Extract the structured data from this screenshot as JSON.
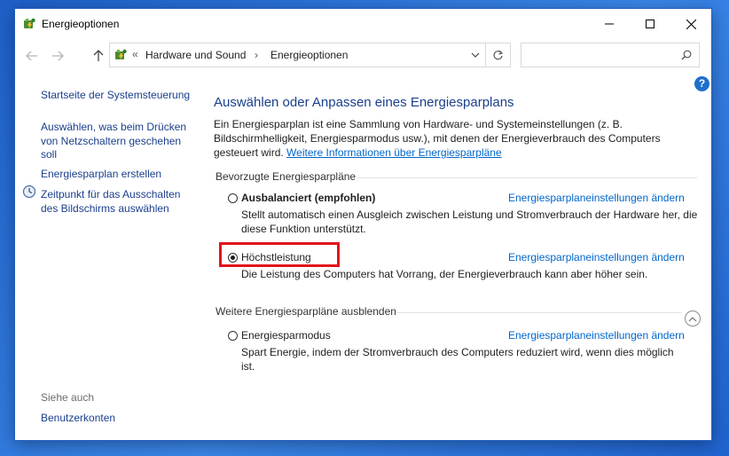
{
  "window": {
    "title": "Energieoptionen"
  },
  "address": {
    "separator": "«",
    "crumbs": [
      "Hardware und Sound",
      "Energieoptionen"
    ],
    "crumb_arrow": "›"
  },
  "search": {
    "placeholder": ""
  },
  "sidebar": {
    "links": [
      "Startseite der Systemsteuerung",
      "Auswählen, was beim Drücken von Netzschaltern geschehen soll",
      "Energiesparplan erstellen",
      "Zeitpunkt für das Ausschalten des Bildschirms auswählen"
    ],
    "see_also_heading": "Siehe auch",
    "see_also_links": [
      "Benutzerkonten"
    ]
  },
  "help": {
    "label": "?"
  },
  "main": {
    "title": "Auswählen oder Anpassen eines Energiesparplans",
    "description": "Ein Energiesparplan ist eine Sammlung von Hardware- und Systemeinstellungen (z. B. Bildschirmhelligkeit, Energiesparmodus usw.), mit denen der Energieverbrauch des Computers gesteuert wird.",
    "more_info_link": "Weitere Informationen über Energiesparpläne",
    "preferred_heading": "Bevorzugte Energiesparpläne",
    "hidden_heading": "Weitere Energiesparpläne ausblenden",
    "change_settings_label": "Energiesparplaneinstellungen ändern",
    "plans": [
      {
        "name": "Ausbalanciert (empfohlen)",
        "description": "Stellt automatisch einen Ausgleich zwischen Leistung und Stromverbrauch der Hardware her, die diese Funktion unterstützt.",
        "selected": false
      },
      {
        "name": "Höchstleistung",
        "description": "Die Leistung des Computers hat Vorrang, der Energieverbrauch kann aber höher sein.",
        "selected": true
      },
      {
        "name": "Energiesparmodus",
        "description": "Spart Energie, indem der Stromverbrauch des Computers reduziert wird, wenn dies möglich ist.",
        "selected": false
      }
    ]
  },
  "colors": {
    "link": "#0066cc",
    "title": "#1a3f8c",
    "highlight": "#e3131b",
    "help": "#1f6fc9"
  }
}
